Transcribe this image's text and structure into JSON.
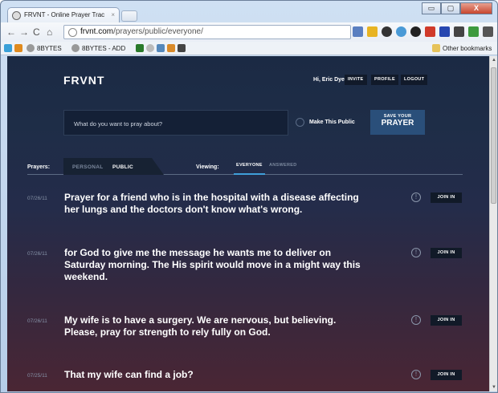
{
  "browser": {
    "tab_title": "FRVNT - Online Prayer Trac",
    "url_host": "frvnt.com",
    "url_path": "/prayers/public/everyone/",
    "bookmarks": [
      "8BYTES",
      "8BYTES - ADD"
    ],
    "other_bookmarks": "Other bookmarks",
    "window_buttons": [
      "▭",
      "▢",
      "X"
    ]
  },
  "header": {
    "logo": "FRVNT",
    "greeting": "Hi, Eric Dye",
    "buttons": [
      "INVITE",
      "PROFILE",
      "LOGOUT"
    ]
  },
  "compose": {
    "placeholder": "What do you want to pray about?",
    "make_public": "Make This Public",
    "save_line1": "SAVE YOUR",
    "save_line2": "PRAYER"
  },
  "filters": {
    "prayers_label": "Prayers:",
    "prayer_tabs": [
      "PERSONAL",
      "PUBLIC"
    ],
    "viewing_label": "Viewing:",
    "viewing_tabs": [
      "EVERYONE",
      "ANSWERED"
    ]
  },
  "prayers": [
    {
      "date": "07/26/11",
      "text": "Prayer for a friend who is in the hospital with a disease affecting her lungs and the doctors don't know what's wrong.",
      "join": "JOIN IN"
    },
    {
      "date": "07/26/11",
      "text": "for God to give me the message he wants me to deliver on Saturday morning. The His spirit would move in a might way this weekend.",
      "join": "JOIN IN"
    },
    {
      "date": "07/26/11",
      "text": "My wife is to have a surgery. We are nervous, but believing. Please, pray for strength to rely fully on God.",
      "join": "JOIN IN"
    },
    {
      "date": "07/25/11",
      "text": "That my wife can find a job?",
      "join": "JOIN IN"
    }
  ]
}
